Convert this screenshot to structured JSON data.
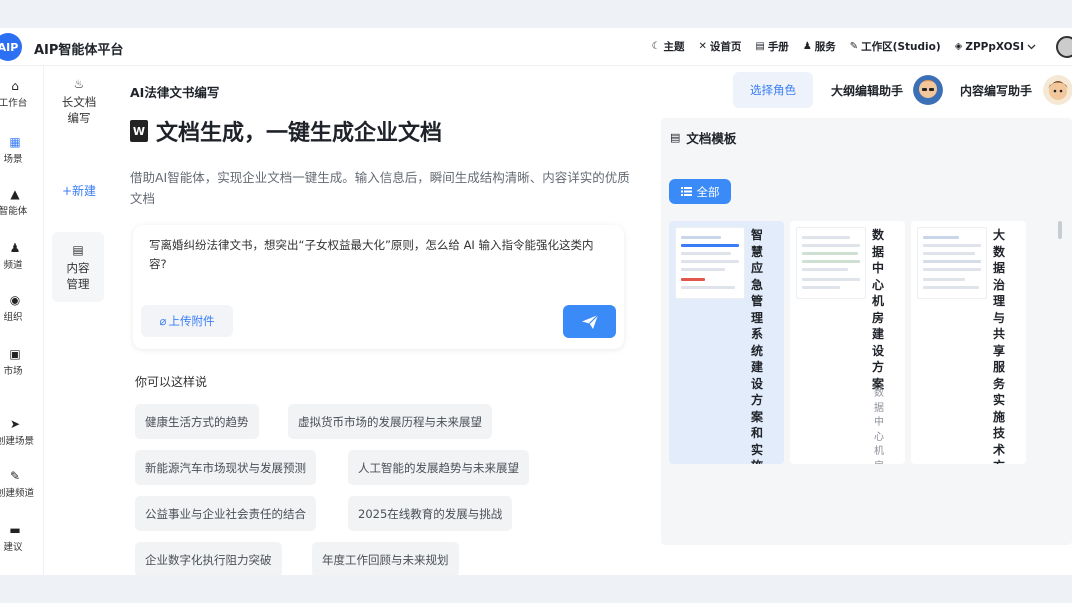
{
  "app": {
    "logo": "AIP",
    "title": "AIP智能体平台"
  },
  "topnav": [
    {
      "icon": "moon-icon",
      "glyph": "☾",
      "label": "主题"
    },
    {
      "icon": "tools-icon",
      "glyph": "✕",
      "label": "设首页"
    },
    {
      "icon": "doc-icon",
      "glyph": "▤",
      "label": "手册"
    },
    {
      "icon": "people-icon",
      "glyph": "♟",
      "label": "服务"
    },
    {
      "icon": "pen-icon",
      "glyph": "✎",
      "label": "工作区(Studio)"
    },
    {
      "icon": "shield-icon",
      "glyph": "◈",
      "label": "ZPPpXOSI"
    }
  ],
  "rail": [
    {
      "name": "home",
      "glyph": "⌂",
      "label": "工作台"
    },
    {
      "name": "scenes",
      "glyph": "▦",
      "label": "场景"
    },
    {
      "name": "agents",
      "glyph": "▲",
      "label": "智能体"
    },
    {
      "name": "channels",
      "glyph": "♟",
      "label": "频道"
    },
    {
      "name": "org",
      "glyph": "◉",
      "label": "组织"
    },
    {
      "name": "market",
      "glyph": "▣",
      "label": "市场"
    },
    {
      "name": "create-scene",
      "glyph": "➤",
      "label": "创建场景"
    },
    {
      "name": "create-channel",
      "glyph": "✎",
      "label": "创建频道"
    },
    {
      "name": "feedback",
      "glyph": "▬",
      "label": "建议"
    }
  ],
  "subside": {
    "longdoc": "长文档\n编写",
    "new": "+新建",
    "content_mgmt": "内容\n管理"
  },
  "main": {
    "breadcrumb": "AI法律文书编写",
    "heading": "文档生成，一键生成企业文档",
    "description": "借助AI智能体，实现企业文档一键生成。输入信息后，瞬间生成结构清晰、内容详实的优质文档",
    "input_value": "写离婚纠纷法律文书，想突出“子女权益最大化”原则，怎么给 AI 输入指令能强化这类内容?",
    "upload_label": "上传附件",
    "suggest_title": "你可以这样说",
    "suggestions": [
      "健康生活方式的趋势",
      "虚拟货币市场的发展历程与未来展望",
      "新能源汽车市场现状与发展预测",
      "人工智能的发展趋势与未来展望",
      "公益事业与企业社会责任的结合",
      "2025在线教育的发展与挑战",
      "企业数字化执行阻力突破",
      "年度工作回顾与未来规划"
    ]
  },
  "roles": {
    "select_label": "选择角色",
    "assistant1": "大纲编辑助手",
    "assistant2": "内容编写助手"
  },
  "templates": {
    "title": "文档模板",
    "filter_all": "全部",
    "cards": [
      {
        "title": "智慧应急管理系统建设方案和实施…",
        "subtitle": ""
      },
      {
        "title": "数据中心机房建设方案",
        "subtitle": "数据中心机房建设方案"
      },
      {
        "title": "大数据治理与共享服务实施技术方…",
        "subtitle": ""
      }
    ]
  },
  "colors": {
    "accent": "#3a8af7",
    "accent_text": "#3a7df6",
    "selected_card": "#e3ecfa"
  }
}
